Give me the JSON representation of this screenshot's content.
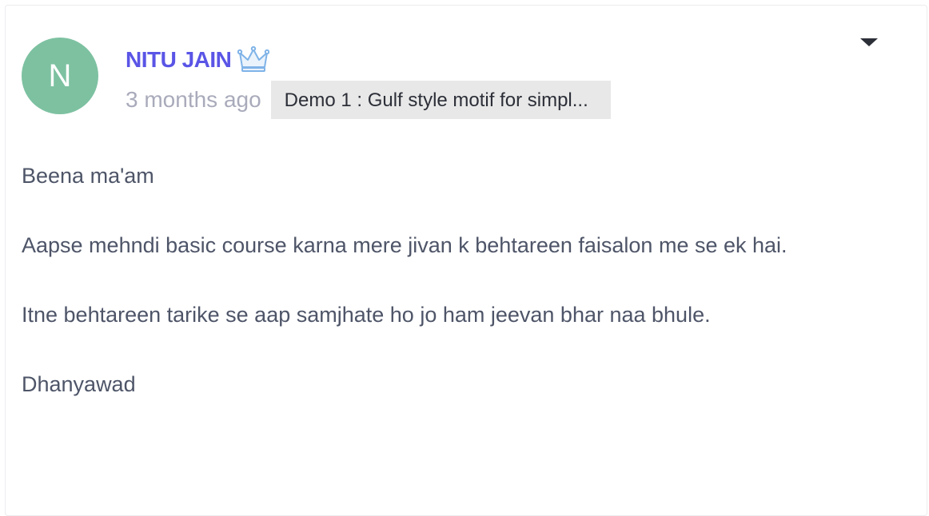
{
  "comment": {
    "avatar_initial": "N",
    "author_name": "NITU JAIN",
    "crown_icon": "crown-icon",
    "timestamp": "3 months ago",
    "lesson_chip": "Demo 1 : Gulf style motif for simpl...",
    "dropdown_icon": "caret-down-icon",
    "paragraphs": [
      "Beena ma'am",
      "Aapse mehndi basic course karna mere jivan k behtareen faisalon me se ek hai.",
      "Itne behtareen tarike se aap samjhate ho jo ham jeevan bhar naa bhule.",
      "Dhanyawad"
    ]
  },
  "colors": {
    "avatar_bg": "#7dc1a1",
    "author_name": "#5a55e6",
    "timestamp": "#a9abbb",
    "chip_bg": "#e8e8e8",
    "body_text": "#4e5568",
    "crown": "#7fb3e8"
  }
}
